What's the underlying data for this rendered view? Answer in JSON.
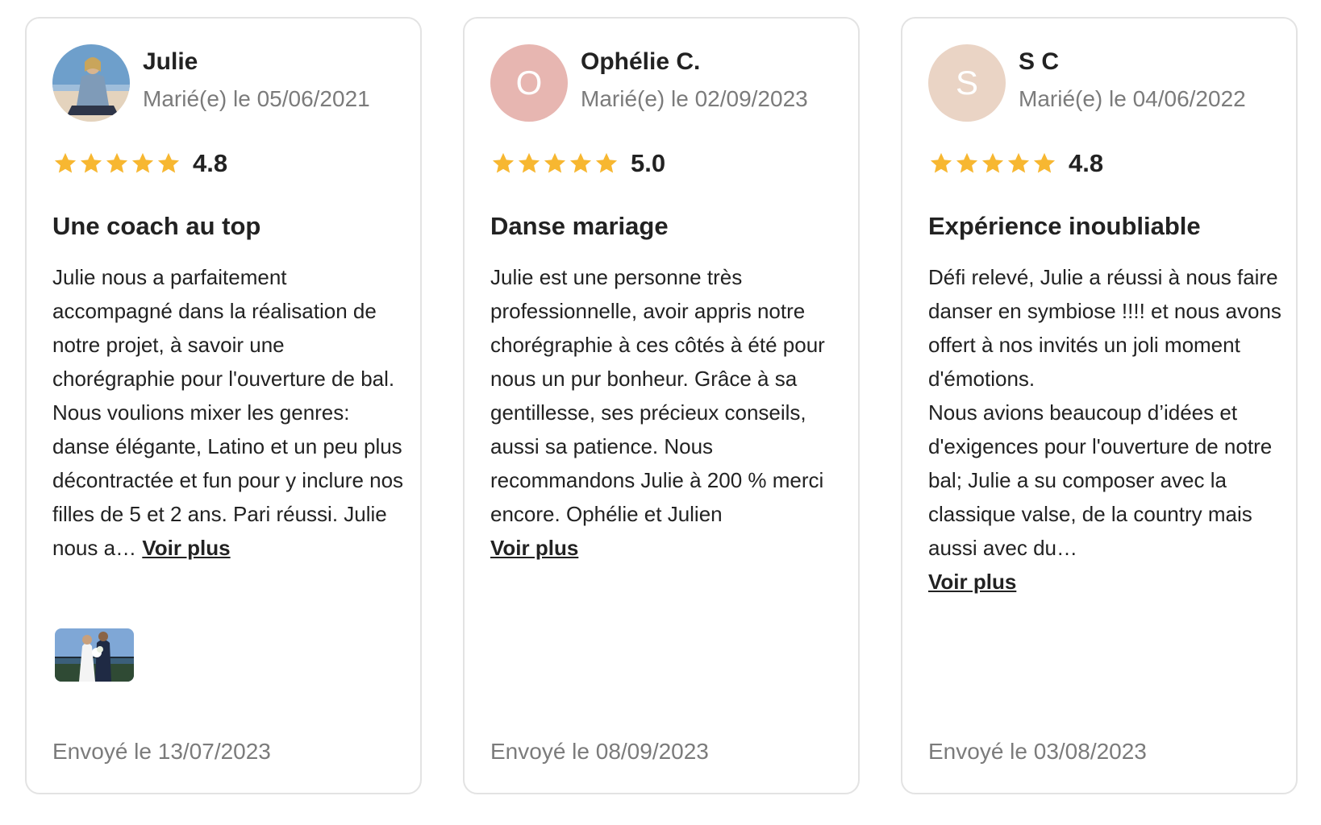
{
  "reviews": [
    {
      "name": "Julie",
      "married": "Marié(e) le 05/06/2021",
      "avatar_type": "photo",
      "rating": "4.8",
      "title": "Une coach au top",
      "body_lines": [
        "Julie nous a parfaitement accompagné dans la réalisation de notre projet, à savoir une chorégraphie pour l'ouverture de bal.",
        "Nous voulions mixer les genres: danse élégante, Latino et un peu plus décontractée et fun pour y inclure nos filles de 5 et 2 ans. Pari réussi. Julie nous a…"
      ],
      "see_more": "Voir plus",
      "has_photo": true,
      "sent": "Envoyé le 13/07/2023"
    },
    {
      "name": "Ophélie C.",
      "married": "Marié(e) le 02/09/2023",
      "avatar_type": "initial",
      "initial": "O",
      "avatar_color": "#e7b6b1",
      "rating": "5.0",
      "title": "Danse mariage",
      "body_lines": [
        "Julie est une personne très professionnelle, avoir appris notre chorégraphie à ces côtés à été pour nous un pur bonheur. Grâce à sa gentillesse, ses précieux conseils, aussi sa patience. Nous recommandons Julie à 200 % merci encore. Ophélie et Julien"
      ],
      "see_more": "Voir plus",
      "has_photo": false,
      "sent": "Envoyé le 08/09/2023"
    },
    {
      "name": "S C",
      "married": "Marié(e) le 04/06/2022",
      "avatar_type": "initial",
      "initial": "S",
      "avatar_color": "#ead4c5",
      "rating": "4.8",
      "title": "Expérience inoubliable",
      "body_lines": [
        "Défi relevé, Julie a réussi à nous faire danser en symbiose !!!! et nous avons offert à nos invités un joli moment d'émotions.",
        "Nous avions beaucoup d’idées et d'exigences pour l'ouverture de notre bal; Julie a su composer avec la classique valse, de la country mais aussi avec du…"
      ],
      "see_more": "Voir plus",
      "has_photo": false,
      "sent": "Envoyé le 03/08/2023"
    }
  ],
  "colors": {
    "star": "#f7b731",
    "muted_text": "#7b7b7b",
    "border": "#e3e3e3"
  },
  "icons": {
    "star": "star-icon",
    "avatar_photo": "avatar-photo",
    "review_photo": "review-photo-thumbnail"
  }
}
